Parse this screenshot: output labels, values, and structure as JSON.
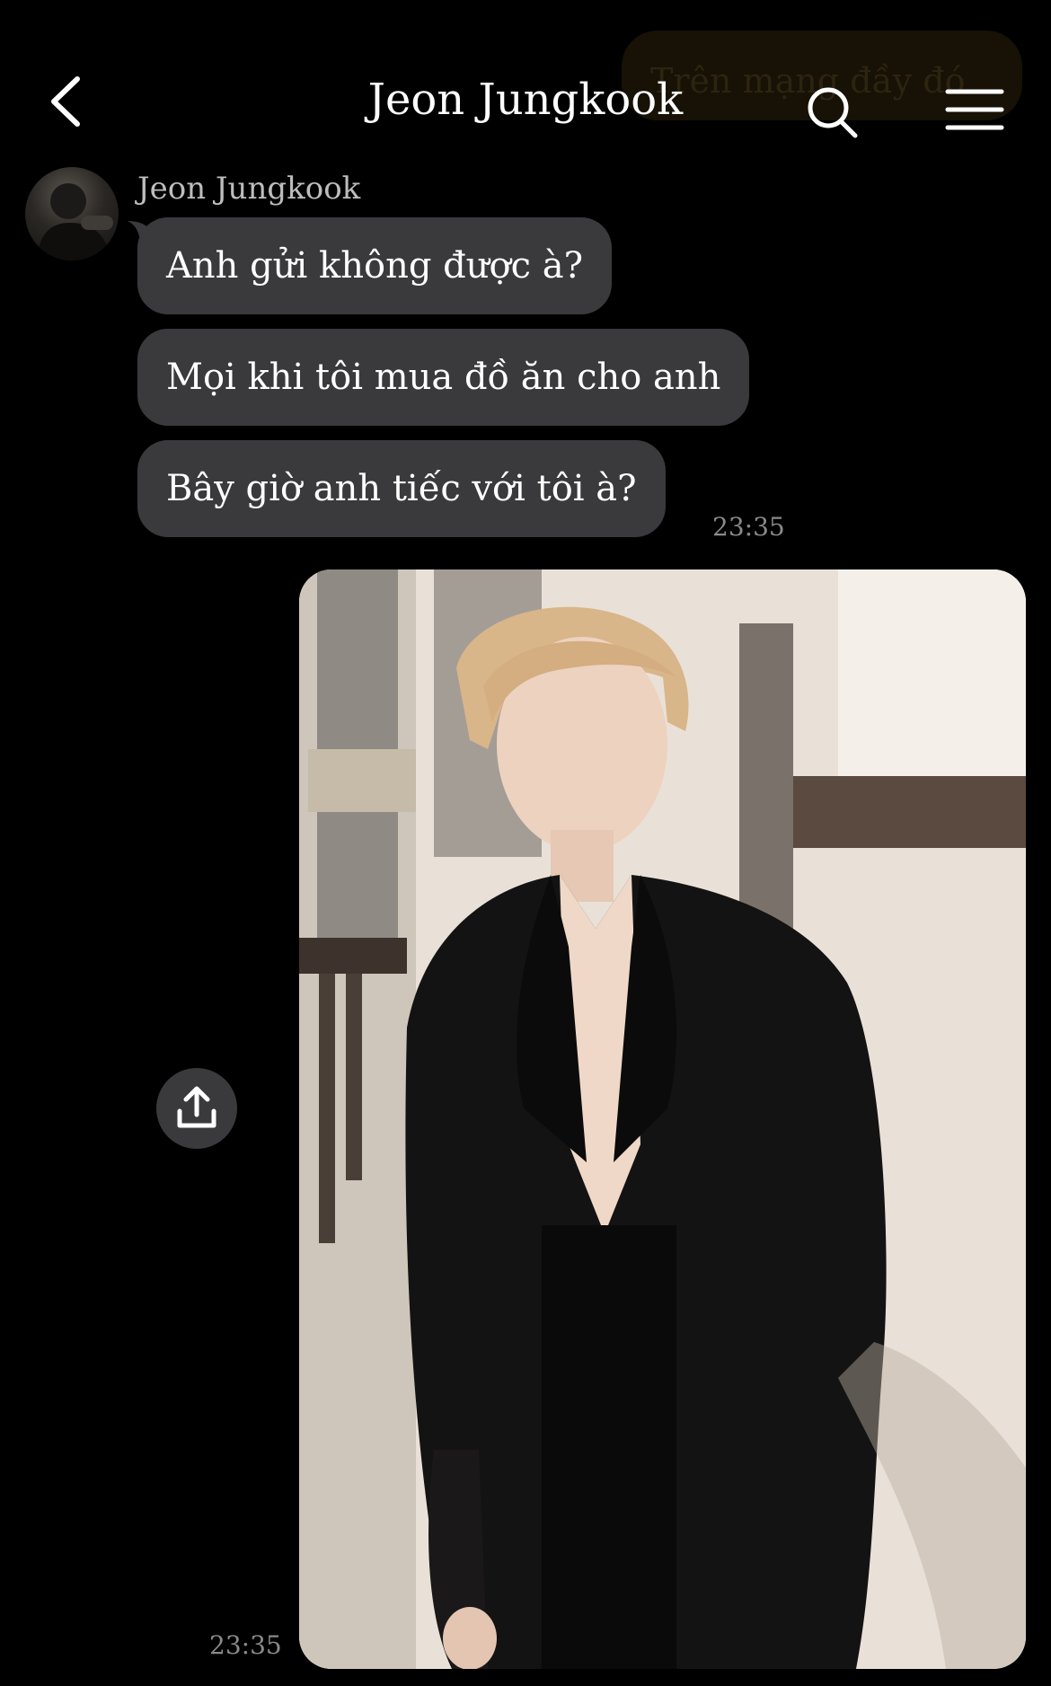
{
  "header": {
    "title": "Jeon Jungkook",
    "faded_preview": "Trên mạng đầy đó"
  },
  "icons": {
    "back": "chevron-left-icon",
    "search": "search-icon",
    "menu": "hamburger-menu-icon",
    "share": "share-upload-icon"
  },
  "chat": {
    "sender_name": "Jeon Jungkook",
    "messages": [
      {
        "text": "Anh gửi không được à?"
      },
      {
        "text": "Mọi khi tôi mua đồ ăn cho anh"
      },
      {
        "text": "Bây giờ anh tiếc với tôi à?"
      }
    ],
    "incoming_time": "23:35",
    "outgoing_time": "23:35"
  },
  "colors": {
    "background": "#000000",
    "bubble": "#3a3a3c",
    "timestamp": "#8a8a8a",
    "sender_name": "#bdbdbd"
  }
}
